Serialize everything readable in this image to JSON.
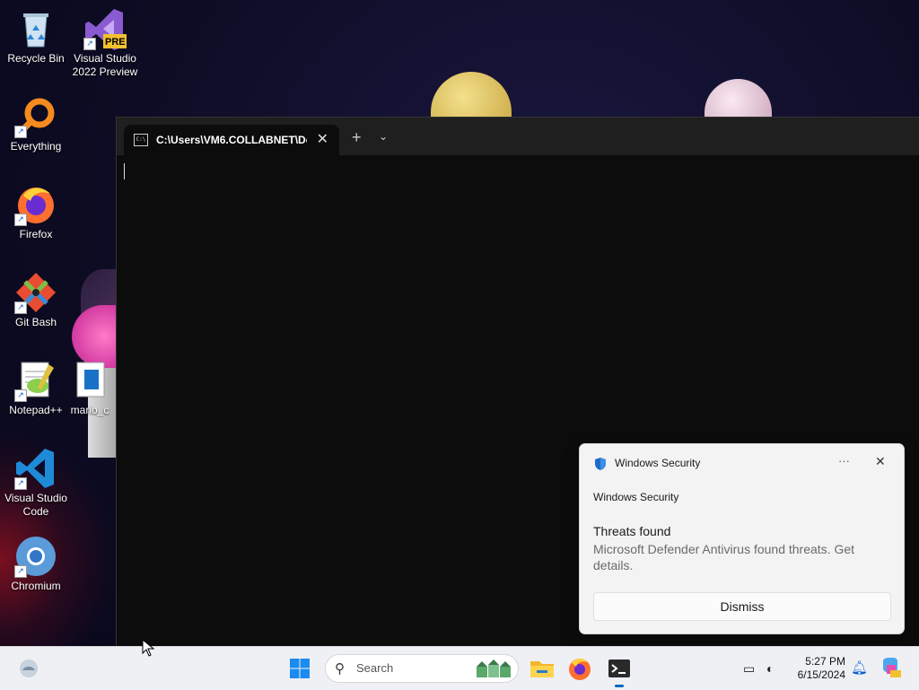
{
  "desktop": {
    "icons": [
      {
        "label": "Recycle Bin",
        "icon": "recycle-bin-icon"
      },
      {
        "label": "Visual Studio 2022 Preview",
        "icon": "visual-studio-icon",
        "badge": "PRE"
      },
      {
        "label": "Everything",
        "icon": "everything-search-icon"
      },
      {
        "label": "Firefox",
        "icon": "firefox-icon"
      },
      {
        "label": "Git Bash",
        "icon": "git-bash-icon"
      },
      {
        "label": "Notepad++",
        "icon": "notepad-plus-plus-icon"
      },
      {
        "label": "mario_c",
        "icon": "document-icon"
      },
      {
        "label": "Visual Studio Code",
        "icon": "vscode-icon"
      },
      {
        "label": "Chromium",
        "icon": "chromium-icon"
      }
    ]
  },
  "terminal": {
    "tab_icon_text": "C:\\",
    "tab_title": "C:\\Users\\VM6.COLLABNET\\De",
    "close_glyph": "✕",
    "new_tab_glyph": "+",
    "dropdown_glyph": "⌄"
  },
  "toast": {
    "app_name": "Windows Security",
    "subtitle": "Windows Security",
    "heading": "Threats found",
    "body": "Microsoft Defender Antivirus found threats. Get details.",
    "dismiss_label": "Dismiss",
    "more_glyph": "···",
    "close_glyph": "✕"
  },
  "taskbar": {
    "search_placeholder": "Search",
    "time": "5:27 PM",
    "date": "6/15/2024",
    "apps": [
      "File Explorer",
      "Firefox",
      "Terminal"
    ]
  },
  "colors": {
    "accent": "#0067c0",
    "terminal_bg": "#0c0c0c",
    "taskbar_bg": "#eef0f4",
    "toast_bg": "#f3f3f3"
  }
}
